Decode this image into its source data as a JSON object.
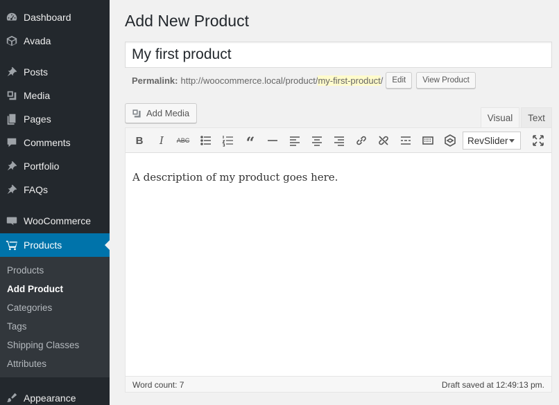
{
  "sidebar": {
    "items": [
      {
        "label": "Dashboard",
        "icon": "dashboard-icon"
      },
      {
        "label": "Avada",
        "icon": "avada-icon"
      },
      {
        "label": "Posts",
        "icon": "pin-icon"
      },
      {
        "label": "Media",
        "icon": "media-icon"
      },
      {
        "label": "Pages",
        "icon": "pages-icon"
      },
      {
        "label": "Comments",
        "icon": "comment-icon"
      },
      {
        "label": "Portfolio",
        "icon": "pin-icon"
      },
      {
        "label": "FAQs",
        "icon": "pin-icon"
      },
      {
        "label": "WooCommerce",
        "icon": "woocommerce-icon"
      },
      {
        "label": "Products",
        "icon": "cart-icon"
      },
      {
        "label": "Appearance",
        "icon": "paintbrush-icon"
      }
    ],
    "submenu": [
      "Products",
      "Add Product",
      "Categories",
      "Tags",
      "Shipping Classes",
      "Attributes"
    ],
    "accent_color": "#0073aa"
  },
  "page": {
    "title": "Add New Product",
    "product_title": "My first product",
    "permalink_label": "Permalink:",
    "permalink_base": "http://woocommerce.local/product/",
    "permalink_slug": "my-first-product",
    "permalink_trailing": "/",
    "edit_label": "Edit",
    "view_label": "View Product"
  },
  "editor": {
    "add_media_label": "Add Media",
    "tab_visual": "Visual",
    "tab_text": "Text",
    "toolbar": [
      "bold-icon",
      "italic-icon",
      "strikethrough-icon",
      "bullet-list-icon",
      "numbered-list-icon",
      "blockquote-icon",
      "horizontal-rule-icon",
      "align-left-icon",
      "align-center-icon",
      "align-right-icon",
      "link-icon",
      "unlink-icon",
      "read-more-icon",
      "toolbar-toggle-icon",
      "fusion-icon"
    ],
    "revslider_label": "RevSlider",
    "content": "A description of my product goes here.",
    "word_count": "Word count: 7",
    "draft_saved": "Draft saved at 12:49:13 pm."
  }
}
